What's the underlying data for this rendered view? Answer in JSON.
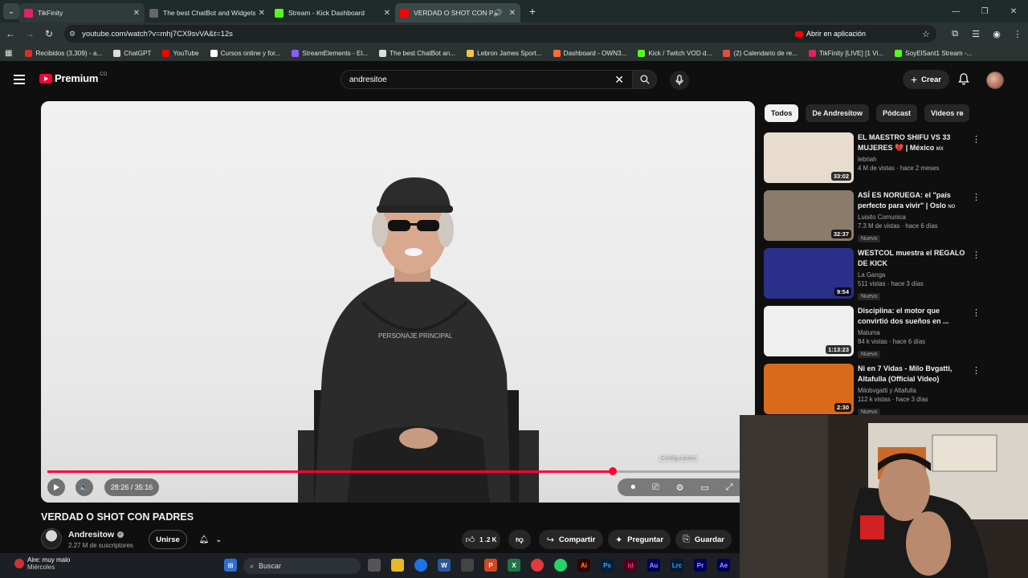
{
  "browser": {
    "tabs": [
      {
        "title": "TikFinity",
        "color": "#e0245e"
      },
      {
        "title": "The best ChatBot and Widgets",
        "color": "#444444"
      },
      {
        "title": "Stream - Kick Dashboard",
        "color": "#53fc18"
      },
      {
        "title": "VERDAD O SHOT CON PAD",
        "color": "#ff0000"
      }
    ],
    "url": "youtube.com/watch?v=mhj7CX9svVA&t=12s",
    "open_in_app": "Abrir en aplicación",
    "bookmarks": [
      {
        "label": "Recibidos (3,309) - a...",
        "color": "#d93025"
      },
      {
        "label": "ChatGPT",
        "color": "#dddddd"
      },
      {
        "label": "YouTube",
        "color": "#ff0000"
      },
      {
        "label": "Cursos online y for...",
        "color": "#ffffff"
      },
      {
        "label": "StreamElements - El...",
        "color": "#8b5cf6"
      },
      {
        "label": "The best ChatBot an...",
        "color": "#dddddd"
      },
      {
        "label": "Lebron James Sport...",
        "color": "#f5c542"
      },
      {
        "label": "Dashboard - OWN3...",
        "color": "#ff6b35"
      },
      {
        "label": "Kick / Twitch VOD d...",
        "color": "#53fc18"
      },
      {
        "label": "(2) Calendario de re...",
        "color": "#e74c3c"
      },
      {
        "label": "TikFinity [LIVE] [1 Vi...",
        "color": "#e0245e"
      },
      {
        "label": "SoyElSant1 Stream -...",
        "color": "#53fc18"
      }
    ]
  },
  "youtube": {
    "logo_text": "Premium",
    "region": "CO",
    "search_query": "andresitoe",
    "create_label": "Crear"
  },
  "video": {
    "title": "VERDAD O SHOT CON PADRES",
    "time": "28:26 / 35:16",
    "progress": 0.817,
    "settings_tooltip": "Configuración",
    "channel": "Andresitow",
    "subscribers": "2.27 M de suscriptores",
    "join_label": "Unirse",
    "like_count": "1 .2 K",
    "share_label": "Compartir",
    "ask_label": "Preguntar",
    "save_label": "Guardar"
  },
  "chips": [
    "Todos",
    "De Andresitow",
    "Pódcast",
    "Videos re"
  ],
  "related": [
    {
      "title": "EL MAESTRO SHIFU VS 33 MUJERES 💔 | México",
      "flag": "MX",
      "channel": "lebriah",
      "stats": "4 M de vistas · hace 2 meses",
      "badge": "",
      "duration": "33:02",
      "thumb": "#e8dccf"
    },
    {
      "title": "ASÍ ES NORUEGA: el \"país perfecto para vivir\" | Oslo",
      "flag": "NO",
      "channel": "Luisito Comunica",
      "stats": "7.3 M de vistas · hace 6 días",
      "badge": "Nuevo",
      "duration": "32:37",
      "thumb": "#8c7a6a"
    },
    {
      "title": "WESTCOL muestra el REGALO DE KICK",
      "flag": "",
      "channel": "La Ganga",
      "stats": "511 vistas · hace 3 días",
      "badge": "Nuevo",
      "duration": "9:54",
      "thumb": "#2a2f8a"
    },
    {
      "title": "Disciplina: el motor que convirtió dos sueños en ...",
      "flag": "",
      "channel": "Maluma",
      "stats": "84 k vistas · hace 6 días",
      "badge": "Nuevo",
      "duration": "1:13:23",
      "thumb": "#efefef"
    },
    {
      "title": "Ni en 7 Vidas - Milo Bvgatti, Altafulla (Official Video)",
      "flag": "",
      "channel": "Milobvgatti y Altafulla",
      "stats": "112 k vistas · hace 3 días",
      "badge": "Nuevo",
      "duration": "2:30",
      "thumb": "#d86a1a"
    }
  ],
  "taskbar": {
    "weather_line1": "Aire: muy malo",
    "weather_line2": "Miércoles",
    "search_placeholder": "Buscar"
  }
}
